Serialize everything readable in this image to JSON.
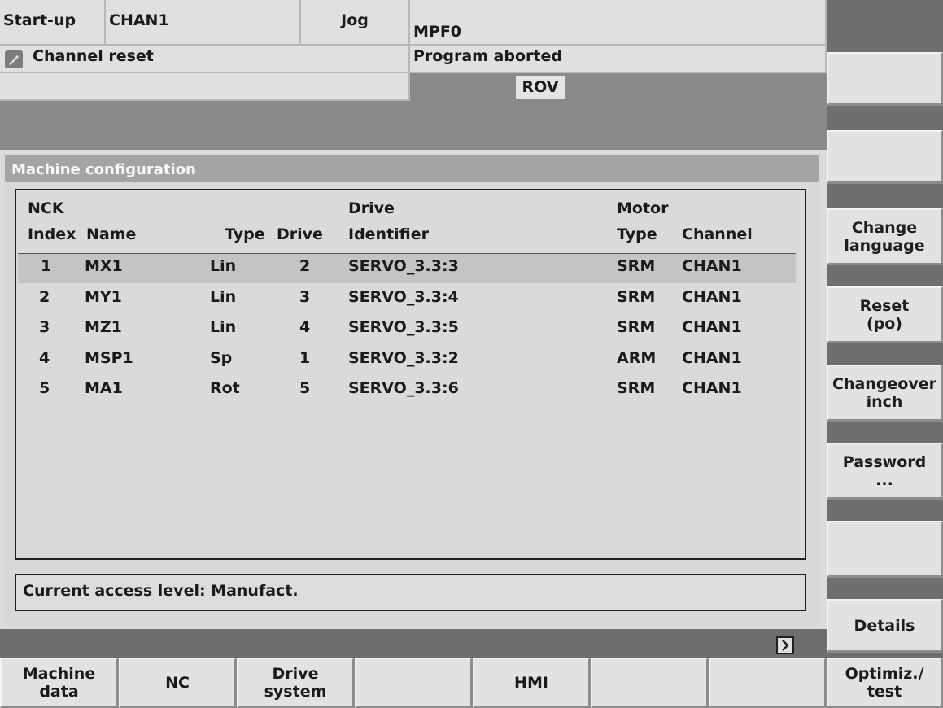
{
  "header": {
    "area": "Start-up",
    "channel": "CHAN1",
    "mode": "Jog",
    "program": "MPF0",
    "channel_status": "Channel reset",
    "program_status": "Program aborted",
    "rov": "ROV",
    "reset_icon": "pencil-icon"
  },
  "window": {
    "title": "Machine configuration",
    "columns": {
      "index_top": "NCK",
      "index": "Index",
      "name": "Name",
      "type": "Type",
      "drive": "Drive",
      "identifier_top": "Drive",
      "identifier": "Identifier",
      "motor_type_top": "Motor",
      "motor_type": "Type",
      "channel": "Channel"
    },
    "rows": [
      {
        "index": "1",
        "name": "MX1",
        "type": "Lin",
        "drive": "2",
        "identifier": "SERVO_3.3:3",
        "motor_type": "SRM",
        "channel": "CHAN1"
      },
      {
        "index": "2",
        "name": "MY1",
        "type": "Lin",
        "drive": "3",
        "identifier": "SERVO_3.3:4",
        "motor_type": "SRM",
        "channel": "CHAN1"
      },
      {
        "index": "3",
        "name": "MZ1",
        "type": "Lin",
        "drive": "4",
        "identifier": "SERVO_3.3:5",
        "motor_type": "SRM",
        "channel": "CHAN1"
      },
      {
        "index": "4",
        "name": "MSP1",
        "type": "Sp",
        "drive": "1",
        "identifier": "SERVO_3.3:2",
        "motor_type": "ARM",
        "channel": "CHAN1"
      },
      {
        "index": "5",
        "name": "MA1",
        "type": "Rot",
        "drive": "5",
        "identifier": "SERVO_3.3:6",
        "motor_type": "SRM",
        "channel": "CHAN1"
      }
    ],
    "access_level": "Current access level: Manufact.",
    "next_icon": "chevron-right-icon"
  },
  "vsoftkeys": {
    "change_language": "Change\nlanguage",
    "reset_po": "Reset\n(po)",
    "changeover_inch": "Changeover\ninch",
    "password": "Password\n...",
    "details": "Details"
  },
  "hsoftkeys": {
    "machine_data": "Machine\ndata",
    "nc": "NC",
    "drive_system": "Drive\nsystem",
    "hmi": "HMI",
    "optimiz_test": "Optimiz./\ntest"
  }
}
